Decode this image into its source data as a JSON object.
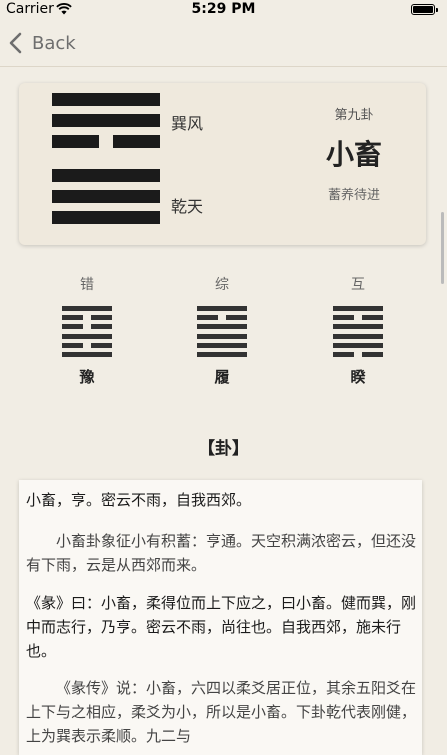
{
  "status_bar": {
    "carrier": "Carrier",
    "time": "5:29 PM"
  },
  "nav": {
    "back_label": "Back"
  },
  "hexagram": {
    "number": "第九卦",
    "name": "小畜",
    "description": "蓄养待进",
    "upper_trigram": "巽风",
    "lower_trigram": "乾天"
  },
  "related": [
    {
      "label": "错",
      "name": "豫"
    },
    {
      "label": "综",
      "name": "履"
    },
    {
      "label": "互",
      "name": "睽"
    }
  ],
  "section_title": "【卦】",
  "text": {
    "judgment": "小畜，亨。密云不雨，自我西郊。",
    "judgment_explain": "小畜卦象征小有积蓄：亨通。天空积满浓密云，但还没有下雨，云是从西郊而来。",
    "tuan": "《彖》曰：小畜，柔得位而上下应之，曰小畜。健而巽，刚中而志行，乃亨。密云不雨，尚往也。自我西郊，施未行也。",
    "tuan_explain": "《彖传》说：小畜，六四以柔爻居正位，其余五阳爻在上下与之相应，柔爻为小，所以是小畜。下卦乾代表刚健，上为巽表示柔顺。九二与"
  }
}
